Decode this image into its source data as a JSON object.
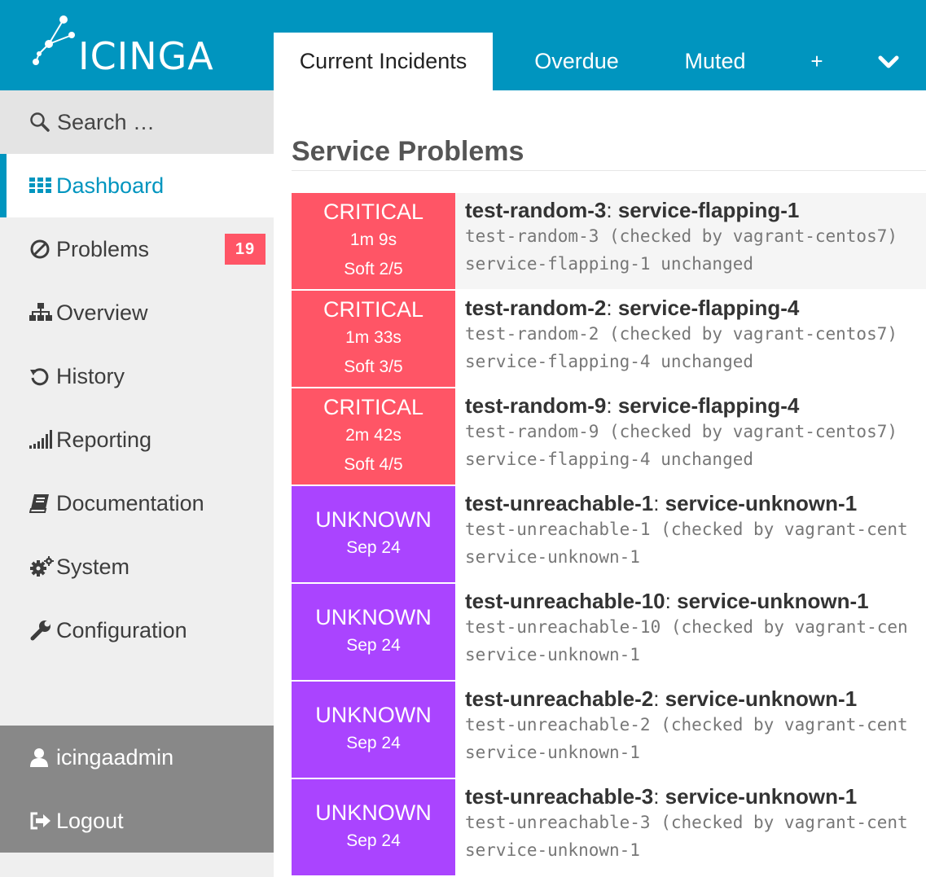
{
  "header": {
    "logo_text": "ICINGA",
    "tabs": [
      {
        "label": "Current Incidents",
        "active": true
      },
      {
        "label": "Overdue"
      },
      {
        "label": "Muted"
      },
      {
        "label": "+"
      }
    ],
    "more_icon": "chevron-down-icon"
  },
  "sidebar": {
    "search_placeholder": "Search …",
    "items": [
      {
        "label": "Dashboard",
        "icon": "dashboard-grid-icon",
        "active": true
      },
      {
        "label": "Problems",
        "icon": "problems-icon",
        "badge": "19"
      },
      {
        "label": "Overview",
        "icon": "sitemap-icon"
      },
      {
        "label": "History",
        "icon": "history-icon"
      },
      {
        "label": "Reporting",
        "icon": "signal-bars-icon"
      },
      {
        "label": "Documentation",
        "icon": "book-icon"
      },
      {
        "label": "System",
        "icon": "gears-icon"
      },
      {
        "label": "Configuration",
        "icon": "wrench-icon"
      }
    ],
    "user": {
      "label": "icingaadmin",
      "icon": "user-icon"
    },
    "logout": {
      "label": "Logout",
      "icon": "logout-icon"
    }
  },
  "main": {
    "section_title": "Service Problems",
    "problems": [
      {
        "state": "CRITICAL",
        "duration": "1m 9s",
        "attempt": "Soft 2/5",
        "host": "test-random-3",
        "service": "service-flapping-1",
        "line1": "test-random-3 (checked by vagrant-centos7)",
        "line2": "service-flapping-1 unchanged"
      },
      {
        "state": "CRITICAL",
        "duration": "1m 33s",
        "attempt": "Soft 3/5",
        "host": "test-random-2",
        "service": "service-flapping-4",
        "line1": "test-random-2 (checked by vagrant-centos7)",
        "line2": "service-flapping-4 unchanged"
      },
      {
        "state": "CRITICAL",
        "duration": "2m 42s",
        "attempt": "Soft 4/5",
        "host": "test-random-9",
        "service": "service-flapping-4",
        "line1": "test-random-9 (checked by vagrant-centos7)",
        "line2": "service-flapping-4 unchanged"
      },
      {
        "state": "UNKNOWN",
        "duration": "Sep 24",
        "host": "test-unreachable-1",
        "service": "service-unknown-1",
        "line1": "test-unreachable-1 (checked by vagrant-cent",
        "line2": "service-unknown-1"
      },
      {
        "state": "UNKNOWN",
        "duration": "Sep 24",
        "host": "test-unreachable-10",
        "service": "service-unknown-1",
        "line1": "test-unreachable-10 (checked by vagrant-cen",
        "line2": "service-unknown-1"
      },
      {
        "state": "UNKNOWN",
        "duration": "Sep 24",
        "host": "test-unreachable-2",
        "service": "service-unknown-1",
        "line1": "test-unreachable-2 (checked by vagrant-cent",
        "line2": "service-unknown-1"
      },
      {
        "state": "UNKNOWN",
        "duration": "Sep 24",
        "host": "test-unreachable-3",
        "service": "service-unknown-1",
        "line1": "test-unreachable-3 (checked by vagrant-cent",
        "line2": "service-unknown-1"
      }
    ]
  },
  "colors": {
    "brand": "#0095bf",
    "critical": "#ff5566",
    "unknown": "#aa44ff",
    "sidebar_bg": "#efefef",
    "user_area_bg": "#888888"
  }
}
